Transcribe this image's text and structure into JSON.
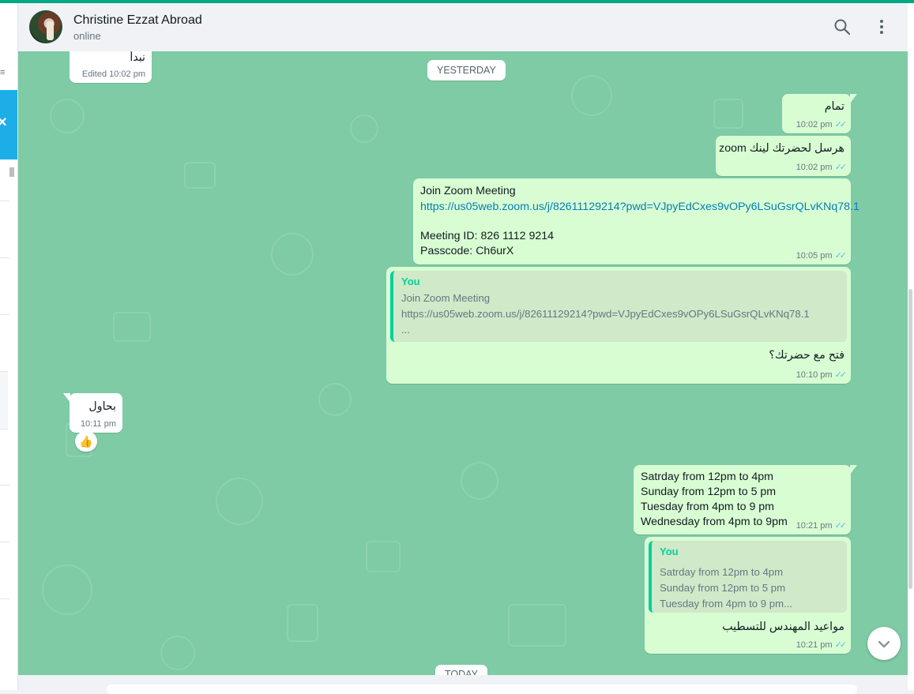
{
  "contact": {
    "name": "Christine Ezzat Abroad",
    "status": "online"
  },
  "header": {
    "search_icon": "search-icon",
    "menu_icon": "more-vertical-icon"
  },
  "date_separators": {
    "yesterday": "YESTERDAY",
    "today": "TODAY"
  },
  "messages": {
    "m0": {
      "text": "نبدأ",
      "time": "Edited 10:02 pm"
    },
    "m1": {
      "text": "تمام",
      "time": "10:02 pm"
    },
    "m2": {
      "text": "هرسل لحضرتك لينك zoom",
      "time": "10:02 pm"
    },
    "m3": {
      "line1": "Join Zoom Meeting",
      "link": "https://us05web.zoom.us/j/82611129214?pwd=VJpyEdCxes9vOPy6LSuGsrQLvKNq78.1",
      "line3": "Meeting ID: 826 1112 9214",
      "line4": "Passcode: Ch6urX",
      "time": "10:05 pm"
    },
    "m4": {
      "quote_author": "You",
      "quote_line1": "Join Zoom Meeting",
      "quote_line2": "https://us05web.zoom.us/j/82611129214?pwd=VJpyEdCxes9vOPy6LSuGsrQLvKNq78.1",
      "quote_line3": "...",
      "text": "فتح مع حضرتك؟",
      "time": "10:10 pm"
    },
    "m5": {
      "text": "بحاول",
      "time": "10:11 pm",
      "reaction": "👍"
    },
    "m6": {
      "line1": "Satrday from 12pm to 4pm",
      "line2": "Sunday from 12pm to 5 pm",
      "line3": "Tuesday from 4pm to 9 pm",
      "line4": "Wednesday from 4pm to 9pm",
      "time": "10:21 pm"
    },
    "m7": {
      "quote_author": "You",
      "quote_line1": "Satrday from 12pm to 4pm",
      "quote_line2": "Sunday from 12pm to 5 pm",
      "quote_line3": "Tuesday from 4pm to 9 pm...",
      "text": "مواعيد المهندس للتسطيب",
      "time": "10:21 pm"
    }
  },
  "colors": {
    "accent": "#00a884",
    "chat_bg": "#7ecba6",
    "outgoing": "#d9fdd3",
    "incoming": "#ffffff",
    "read_tick": "#53bdeb",
    "link": "#027eb5"
  }
}
